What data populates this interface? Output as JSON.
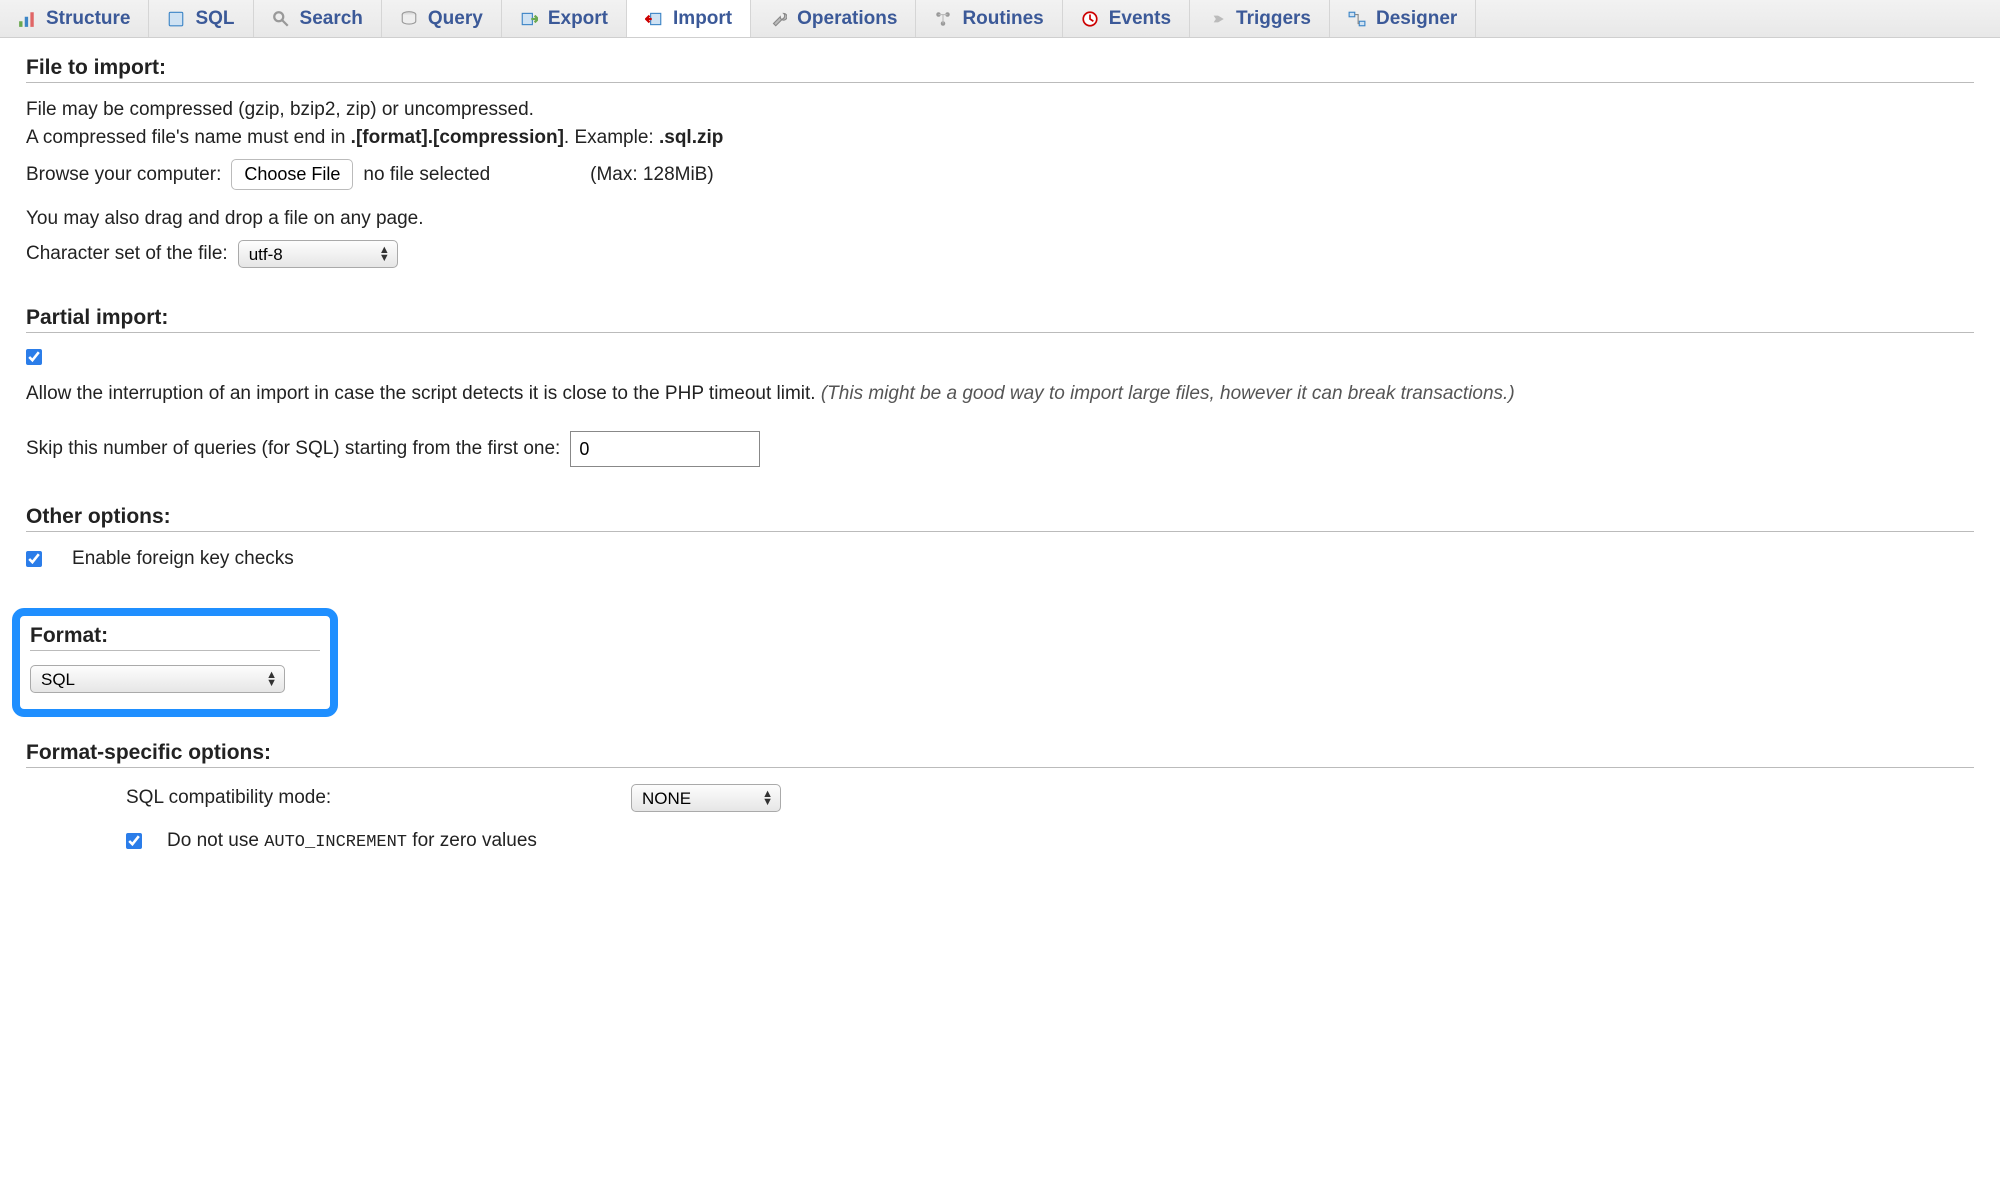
{
  "tabs": [
    {
      "label": "Structure",
      "icon": "structure"
    },
    {
      "label": "SQL",
      "icon": "sql"
    },
    {
      "label": "Search",
      "icon": "search"
    },
    {
      "label": "Query",
      "icon": "query"
    },
    {
      "label": "Export",
      "icon": "export"
    },
    {
      "label": "Import",
      "icon": "import",
      "active": true
    },
    {
      "label": "Operations",
      "icon": "operations"
    },
    {
      "label": "Routines",
      "icon": "routines"
    },
    {
      "label": "Events",
      "icon": "events"
    },
    {
      "label": "Triggers",
      "icon": "triggers"
    },
    {
      "label": "Designer",
      "icon": "designer"
    }
  ],
  "file_to_import": {
    "heading": "File to import:",
    "line1": "File may be compressed (gzip, bzip2, zip) or uncompressed.",
    "line2_pre": "A compressed file's name must end in ",
    "line2_bold1": ".[format].[compression]",
    "line2_mid": ". Example: ",
    "line2_bold2": ".sql.zip",
    "browse_label": "Browse your computer:",
    "choose_file_btn": "Choose File",
    "no_file_text": "no file selected",
    "max_label": "(Max: 128MiB)",
    "dragdrop_text": "You may also drag and drop a file on any page.",
    "charset_label": "Character set of the file:",
    "charset_value": "utf-8"
  },
  "partial_import": {
    "heading": "Partial import:",
    "allow_checked": true,
    "allow_text": "Allow the interruption of an import in case the script detects it is close to the PHP timeout limit. ",
    "allow_hint": "(This might be a good way to import large files, however it can break transactions.)",
    "skip_label": "Skip this number of queries (for SQL) starting from the first one:",
    "skip_value": "0"
  },
  "other_options": {
    "heading": "Other options:",
    "fk_checked": true,
    "fk_label": "Enable foreign key checks"
  },
  "format": {
    "heading": "Format:",
    "value": "SQL"
  },
  "format_specific": {
    "heading": "Format-specific options:",
    "compat_label": "SQL compatibility mode:",
    "compat_value": "NONE",
    "noauto_checked": true,
    "noauto_pre": "Do not use ",
    "noauto_mono": "AUTO_INCREMENT",
    "noauto_post": " for zero values"
  }
}
